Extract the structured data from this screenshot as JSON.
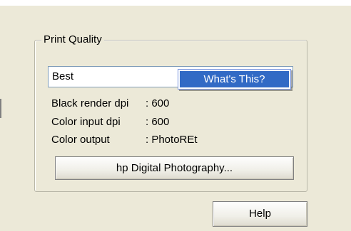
{
  "group": {
    "title": "Print Quality"
  },
  "quality_select": {
    "value": "Best"
  },
  "context_menu": {
    "item": "What's This?"
  },
  "info": [
    {
      "label": "Black render dpi",
      "value": ": 600"
    },
    {
      "label": "Color input dpi",
      "value": ": 600"
    },
    {
      "label": "Color output",
      "value": ": PhotoREt"
    }
  ],
  "buttons": {
    "photo": "hp Digital Photography...",
    "help": "Help"
  },
  "colors": {
    "dialog_bg": "#ece9d8",
    "selection": "#316ac5"
  }
}
